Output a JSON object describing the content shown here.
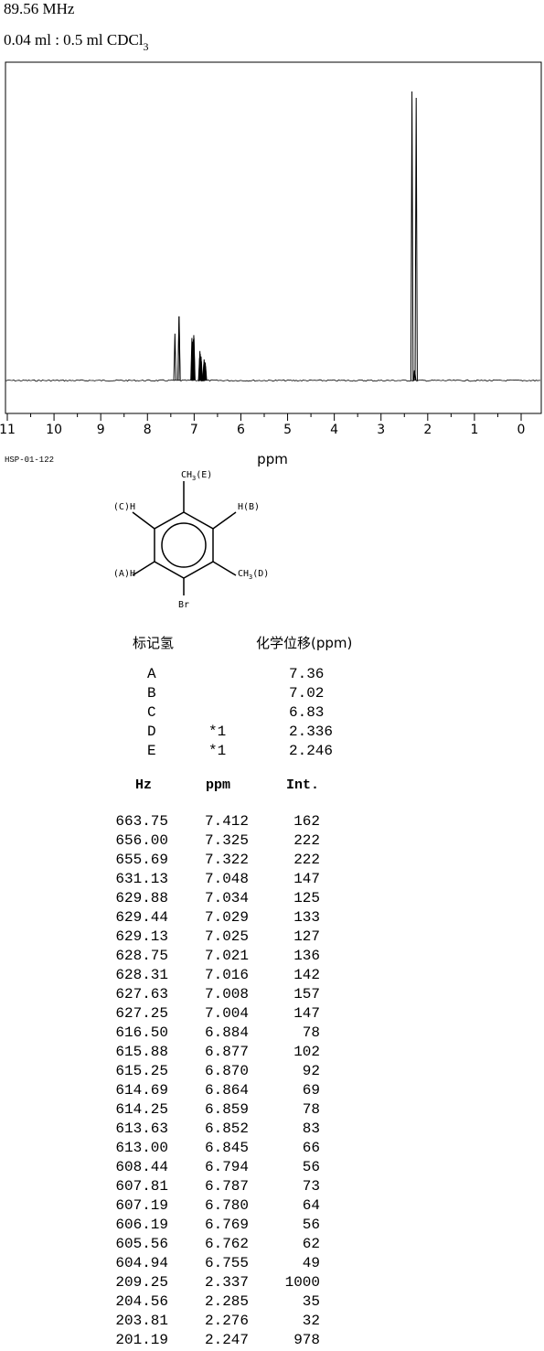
{
  "header": {
    "frequency": "89.56 MHz",
    "sample_main": "0.04 ml : 0.5 ml CDCl",
    "sample_sub": "3"
  },
  "chart_data": {
    "type": "line",
    "xlabel": "ppm",
    "x_ticks": [
      "11",
      "10",
      "9",
      "8",
      "7",
      "6",
      "5",
      "4",
      "3",
      "2",
      "1",
      "0"
    ],
    "xlim": [
      11,
      0
    ],
    "x_reversed": true,
    "grid": false,
    "baseline_level": 0.055,
    "peaks": [
      {
        "ppm": 7.412,
        "rel_intensity": 162
      },
      {
        "ppm": 7.325,
        "rel_intensity": 222
      },
      {
        "ppm": 7.322,
        "rel_intensity": 222
      },
      {
        "ppm": 7.048,
        "rel_intensity": 147
      },
      {
        "ppm": 7.034,
        "rel_intensity": 125
      },
      {
        "ppm": 7.029,
        "rel_intensity": 133
      },
      {
        "ppm": 7.025,
        "rel_intensity": 127
      },
      {
        "ppm": 7.021,
        "rel_intensity": 136
      },
      {
        "ppm": 7.016,
        "rel_intensity": 142
      },
      {
        "ppm": 7.008,
        "rel_intensity": 157
      },
      {
        "ppm": 7.004,
        "rel_intensity": 147
      },
      {
        "ppm": 6.884,
        "rel_intensity": 78
      },
      {
        "ppm": 6.877,
        "rel_intensity": 102
      },
      {
        "ppm": 6.87,
        "rel_intensity": 92
      },
      {
        "ppm": 6.864,
        "rel_intensity": 69
      },
      {
        "ppm": 6.859,
        "rel_intensity": 78
      },
      {
        "ppm": 6.852,
        "rel_intensity": 83
      },
      {
        "ppm": 6.845,
        "rel_intensity": 66
      },
      {
        "ppm": 6.794,
        "rel_intensity": 56
      },
      {
        "ppm": 6.787,
        "rel_intensity": 73
      },
      {
        "ppm": 6.78,
        "rel_intensity": 64
      },
      {
        "ppm": 6.769,
        "rel_intensity": 56
      },
      {
        "ppm": 6.762,
        "rel_intensity": 62
      },
      {
        "ppm": 6.755,
        "rel_intensity": 49
      },
      {
        "ppm": 2.337,
        "rel_intensity": 1000
      },
      {
        "ppm": 2.285,
        "rel_intensity": 35
      },
      {
        "ppm": 2.276,
        "rel_intensity": 32
      },
      {
        "ppm": 2.247,
        "rel_intensity": 978
      }
    ]
  },
  "spectrum_code": "HSP-01-122",
  "structure": {
    "label_top": "CH3(E)",
    "label_top_main": "CH",
    "label_top_sub": "3",
    "label_top_suffix": "(E)",
    "label_upper_left": "(C)H",
    "label_upper_right": "H(B)",
    "label_lower_left": "(A)H",
    "label_lower_right_main": "CH",
    "label_lower_right_sub": "3",
    "label_lower_right_suffix": "(D)",
    "label_bottom": "Br"
  },
  "assignment_table": {
    "col_hydrogen": "标记氢",
    "col_shift": "化学位移(ppm)",
    "rows": [
      {
        "label": "A",
        "note": "",
        "shift": "7.36"
      },
      {
        "label": "B",
        "note": "",
        "shift": "7.02"
      },
      {
        "label": "C",
        "note": "",
        "shift": "6.83"
      },
      {
        "label": "D",
        "note": "*1",
        "shift": "2.336"
      },
      {
        "label": "E",
        "note": "*1",
        "shift": "2.246"
      }
    ]
  },
  "peak_table": {
    "headers": {
      "hz": "Hz",
      "ppm": "ppm",
      "int": "Int."
    },
    "rows": [
      {
        "hz": "663.75",
        "ppm": "7.412",
        "int": "162"
      },
      {
        "hz": "656.00",
        "ppm": "7.325",
        "int": "222"
      },
      {
        "hz": "655.69",
        "ppm": "7.322",
        "int": "222"
      },
      {
        "hz": "631.13",
        "ppm": "7.048",
        "int": "147"
      },
      {
        "hz": "629.88",
        "ppm": "7.034",
        "int": "125"
      },
      {
        "hz": "629.44",
        "ppm": "7.029",
        "int": "133"
      },
      {
        "hz": "629.13",
        "ppm": "7.025",
        "int": "127"
      },
      {
        "hz": "628.75",
        "ppm": "7.021",
        "int": "136"
      },
      {
        "hz": "628.31",
        "ppm": "7.016",
        "int": "142"
      },
      {
        "hz": "627.63",
        "ppm": "7.008",
        "int": "157"
      },
      {
        "hz": "627.25",
        "ppm": "7.004",
        "int": "147"
      },
      {
        "hz": "616.50",
        "ppm": "6.884",
        "int": "78"
      },
      {
        "hz": "615.88",
        "ppm": "6.877",
        "int": "102"
      },
      {
        "hz": "615.25",
        "ppm": "6.870",
        "int": "92"
      },
      {
        "hz": "614.69",
        "ppm": "6.864",
        "int": "69"
      },
      {
        "hz": "614.25",
        "ppm": "6.859",
        "int": "78"
      },
      {
        "hz": "613.63",
        "ppm": "6.852",
        "int": "83"
      },
      {
        "hz": "613.00",
        "ppm": "6.845",
        "int": "66"
      },
      {
        "hz": "608.44",
        "ppm": "6.794",
        "int": "56"
      },
      {
        "hz": "607.81",
        "ppm": "6.787",
        "int": "73"
      },
      {
        "hz": "607.19",
        "ppm": "6.780",
        "int": "64"
      },
      {
        "hz": "606.19",
        "ppm": "6.769",
        "int": "56"
      },
      {
        "hz": "605.56",
        "ppm": "6.762",
        "int": "62"
      },
      {
        "hz": "604.94",
        "ppm": "6.755",
        "int": "49"
      },
      {
        "hz": "209.25",
        "ppm": "2.337",
        "int": "1000"
      },
      {
        "hz": "204.56",
        "ppm": "2.285",
        "int": "35"
      },
      {
        "hz": "203.81",
        "ppm": "2.276",
        "int": "32"
      },
      {
        "hz": "201.19",
        "ppm": "2.247",
        "int": "978"
      }
    ]
  }
}
